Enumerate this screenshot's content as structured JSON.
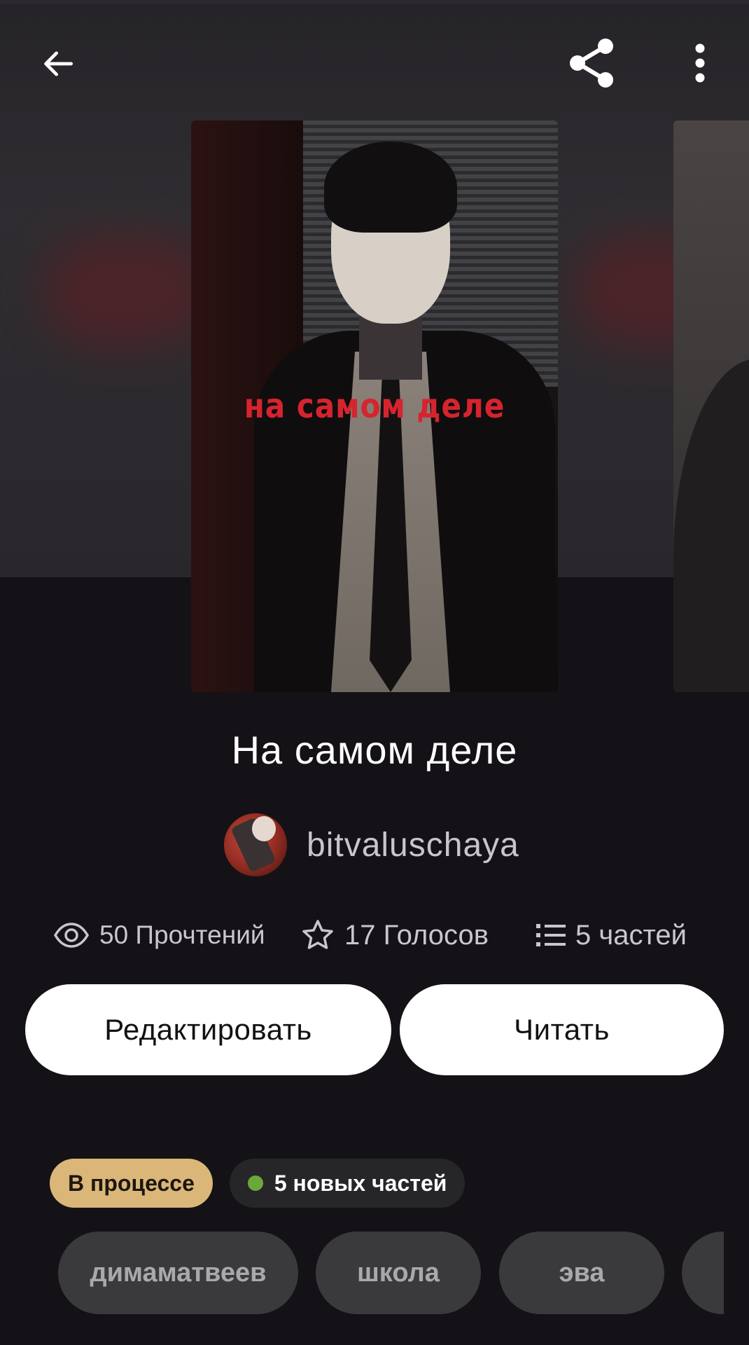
{
  "toolbar": {
    "back_icon": "arrow-left-icon",
    "share_icon": "share-icon",
    "more_icon": "more-vertical-icon"
  },
  "story": {
    "cover_text": "на самом деле",
    "title": "На самом деле",
    "author": "bitvaluschaya"
  },
  "stats": {
    "reads": "50 Прочтений",
    "votes": "17 Голосов",
    "parts": "5 частей"
  },
  "actions": {
    "edit_label": "Редактировать",
    "read_label": "Читать"
  },
  "badges": {
    "status": "В процессе",
    "new_parts": "5 новых частей"
  },
  "tags": [
    "димаматвеев",
    "школа",
    "эва"
  ],
  "colors": {
    "background": "#141216",
    "status_badge": "#dab679",
    "new_dot": "#6ba839",
    "cover_title_red": "#d6242f",
    "tag_bg": "#3a3a3d"
  }
}
